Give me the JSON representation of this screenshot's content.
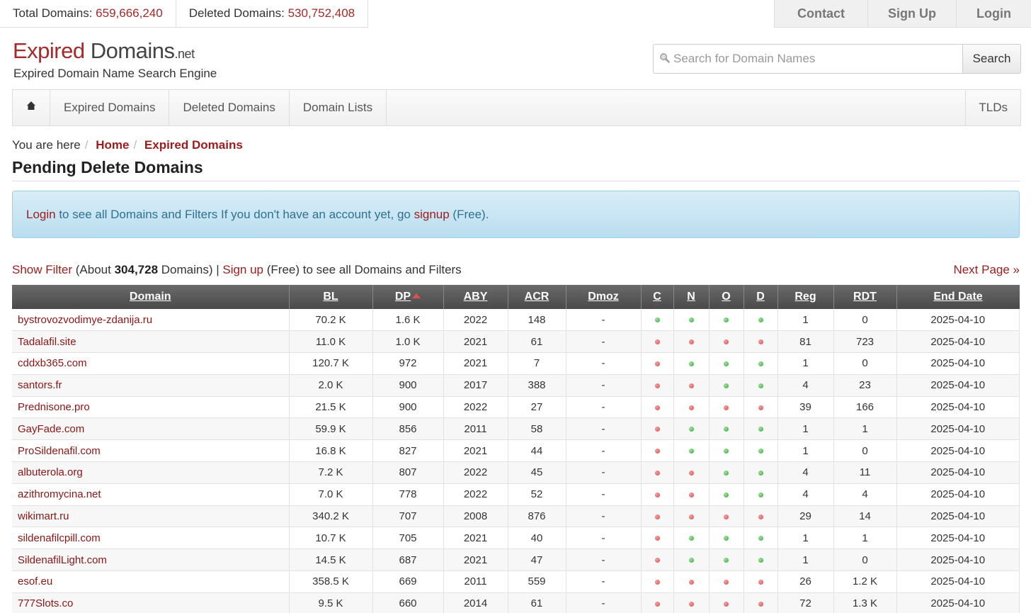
{
  "stats": {
    "total_label": "Total Domains:",
    "total_value": "659,666,240",
    "deleted_label": "Deleted Domains:",
    "deleted_value": "530,752,408"
  },
  "topnav": {
    "contact": "Contact",
    "signup": "Sign Up",
    "login": "Login"
  },
  "logo": {
    "part1": "Expired",
    "part2": " Domains",
    "part3": ".net",
    "tagline": "Expired Domain Name Search Engine"
  },
  "search": {
    "placeholder": "Search for Domain Names",
    "button": "Search"
  },
  "nav": {
    "home_icon": "home-icon",
    "items": [
      "Expired Domains",
      "Deleted Domains",
      "Domain Lists"
    ],
    "tlds": "TLDs"
  },
  "breadcrumb": {
    "prefix": "You are here",
    "home": "Home",
    "current": "Expired Domains"
  },
  "page_title": "Pending Delete Domains",
  "alert": {
    "login": "Login",
    "text1": " to see all Domains and Filters If you don't have an account yet, go ",
    "signup": "signup",
    "text2": " (Free)."
  },
  "filter": {
    "show": "Show Filter",
    "about_prefix": " (About ",
    "count": "304,728",
    "about_suffix": " Domains) | ",
    "signup": "Sign up",
    "rest": " (Free) to see all Domains and Filters",
    "next": "Next Page »"
  },
  "table": {
    "headers": [
      "Domain",
      "BL",
      "DP",
      "ABY",
      "ACR",
      "Dmoz",
      "C",
      "N",
      "O",
      "D",
      "Reg",
      "RDT",
      "End Date"
    ],
    "rows": [
      {
        "domain": "bystrovozvodimye-zdanija.ru",
        "bl": "70.2 K",
        "dp": "1.6 K",
        "aby": "2022",
        "acr": "148",
        "dmoz": "-",
        "c": "g",
        "n": "g",
        "o": "g",
        "d": "g",
        "reg": "1",
        "rdt": "0",
        "end": "2025-04-10",
        "end_color": "g"
      },
      {
        "domain": "Tadalafil.site",
        "bl": "11.0 K",
        "dp": "1.0 K",
        "aby": "2021",
        "acr": "61",
        "dmoz": "-",
        "c": "r",
        "n": "r",
        "o": "r",
        "d": "r",
        "reg": "81",
        "rdt": "723",
        "end": "2025-04-10",
        "end_color": "g"
      },
      {
        "domain": "cddxb365.com",
        "bl": "120.7 K",
        "dp": "972",
        "aby": "2021",
        "acr": "7",
        "dmoz": "-",
        "c": "r",
        "n": "g",
        "o": "g",
        "d": "g",
        "reg": "1",
        "rdt": "0",
        "end": "2025-04-10",
        "end_color": "g"
      },
      {
        "domain": "santors.fr",
        "bl": "2.0 K",
        "dp": "900",
        "aby": "2017",
        "acr": "388",
        "dmoz": "-",
        "c": "r",
        "n": "r",
        "o": "g",
        "d": "g",
        "reg": "4",
        "rdt": "23",
        "end": "2025-04-10",
        "end_color": "g"
      },
      {
        "domain": "Prednisone.pro",
        "bl": "21.5 K",
        "dp": "900",
        "aby": "2022",
        "acr": "27",
        "dmoz": "-",
        "c": "r",
        "n": "r",
        "o": "r",
        "d": "r",
        "reg": "39",
        "rdt": "166",
        "end": "2025-04-10",
        "end_color": "g"
      },
      {
        "domain": "GayFade.com",
        "bl": "59.9 K",
        "dp": "856",
        "aby": "2011",
        "acr": "58",
        "dmoz": "-",
        "c": "r",
        "n": "g",
        "o": "g",
        "d": "g",
        "reg": "1",
        "rdt": "1",
        "end": "2025-04-10",
        "end_color": "g"
      },
      {
        "domain": "ProSildenafil.com",
        "bl": "16.8 K",
        "dp": "827",
        "aby": "2021",
        "acr": "44",
        "dmoz": "-",
        "c": "r",
        "n": "g",
        "o": "g",
        "d": "g",
        "reg": "1",
        "rdt": "0",
        "end": "2025-04-10",
        "end_color": "g"
      },
      {
        "domain": "albuterola.org",
        "bl": "7.2 K",
        "dp": "807",
        "aby": "2022",
        "acr": "45",
        "dmoz": "-",
        "c": "r",
        "n": "r",
        "o": "g",
        "d": "g",
        "reg": "4",
        "rdt": "11",
        "end": "2025-04-10",
        "end_color": "g"
      },
      {
        "domain": "azithromycina.net",
        "bl": "7.0 K",
        "dp": "778",
        "aby": "2022",
        "acr": "52",
        "dmoz": "-",
        "c": "r",
        "n": "r",
        "o": "g",
        "d": "g",
        "reg": "4",
        "rdt": "4",
        "end": "2025-04-10",
        "end_color": "g"
      },
      {
        "domain": "wikimart.ru",
        "bl": "340.2 K",
        "dp": "707",
        "aby": "2008",
        "acr": "876",
        "dmoz": "-",
        "c": "r",
        "n": "r",
        "o": "r",
        "d": "r",
        "reg": "29",
        "rdt": "14",
        "end": "2025-04-10",
        "end_color": "g"
      },
      {
        "domain": "sildenafilcpill.com",
        "bl": "10.7 K",
        "dp": "705",
        "aby": "2021",
        "acr": "40",
        "dmoz": "-",
        "c": "r",
        "n": "g",
        "o": "g",
        "d": "g",
        "reg": "1",
        "rdt": "1",
        "end": "2025-04-10",
        "end_color": "g"
      },
      {
        "domain": "SildenafilLight.com",
        "bl": "14.5 K",
        "dp": "687",
        "aby": "2021",
        "acr": "47",
        "dmoz": "-",
        "c": "r",
        "n": "g",
        "o": "g",
        "d": "g",
        "reg": "1",
        "rdt": "0",
        "end": "2025-04-10",
        "end_color": "g"
      },
      {
        "domain": "esof.eu",
        "bl": "358.5 K",
        "dp": "669",
        "aby": "2011",
        "acr": "559",
        "dmoz": "-",
        "c": "r",
        "n": "r",
        "o": "r",
        "d": "r",
        "reg": "26",
        "rdt": "1.2 K",
        "end": "2025-04-10",
        "end_color": "r"
      },
      {
        "domain": "777Slots.co",
        "bl": "9.5 K",
        "dp": "660",
        "aby": "2014",
        "acr": "61",
        "dmoz": "-",
        "c": "r",
        "n": "r",
        "o": "r",
        "d": "r",
        "reg": "72",
        "rdt": "1.3 K",
        "end": "2025-04-10",
        "end_color": "g"
      }
    ]
  },
  "colors": {
    "brand": "#a52a2a",
    "link": "#9b1c1c",
    "status_ok": "#3aa53a",
    "status_bad": "#d44d4d"
  }
}
